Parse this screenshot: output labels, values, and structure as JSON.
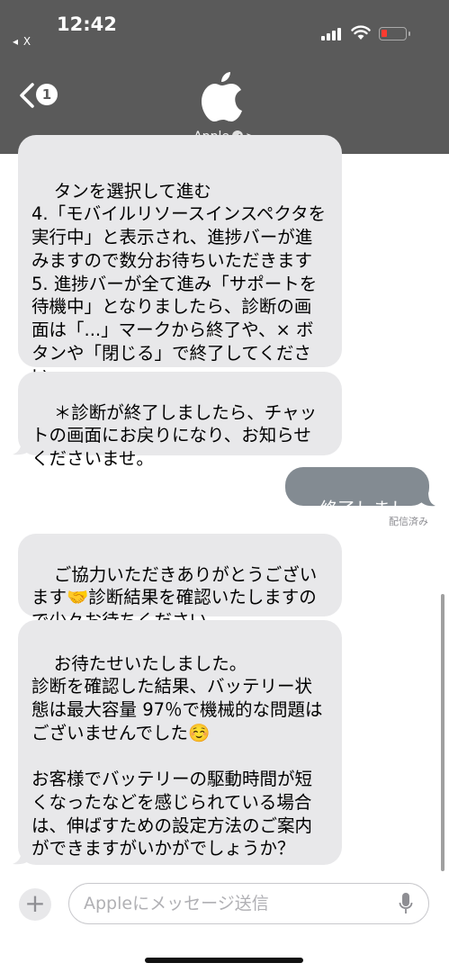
{
  "status_bar": {
    "time": "12:42",
    "back_app": "◂ X",
    "battery_color": "#ff3b30"
  },
  "header": {
    "back_count": "1",
    "contact_name": "Apple",
    "contact_chevron": ">",
    "logo_icon": "apple-logo",
    "background_color": "#5a5a5a"
  },
  "messages": [
    {
      "direction": "incoming",
      "text": "タンを選択して進む\n4.「モバイルリソースインスペクタを実行中」と表示され、進捗バーが進みますので数分お待ちいただきます\n5. 進捗バーが全て進み「サポートを待機中」となりましたら、診断の画面は「...」マークから終了や、× ボタンや「閉じる」で終了してください"
    },
    {
      "direction": "incoming",
      "text": "＊診断が終了しましたら、チャットの画面にお戻りになり、お知らせくださいませ。"
    },
    {
      "direction": "outgoing",
      "text": "終了しました。"
    },
    {
      "direction": "incoming",
      "text": "ご協力いただきありがとうございます🤝診断結果を確認いたしますので少々お待ちください。"
    },
    {
      "direction": "incoming",
      "text": "お待たせいたしました。\n診断を確認した結果、バッテリー状態は最大容量 97％で機械的な問題はございませんでした☺️\n\nお客様でバッテリーの駆動時間が短くなったなどを感じられている場合は、伸ばすための設定方法のご案内ができますがいかがでしょうか？\n"
    }
  ],
  "delivery_status": "配信済み",
  "composer": {
    "plus_label": "+",
    "placeholder": "Appleにメッセージ送信",
    "value": ""
  },
  "colors": {
    "incoming_bubble": "#e8e8ea",
    "outgoing_bubble": "#838b92"
  }
}
